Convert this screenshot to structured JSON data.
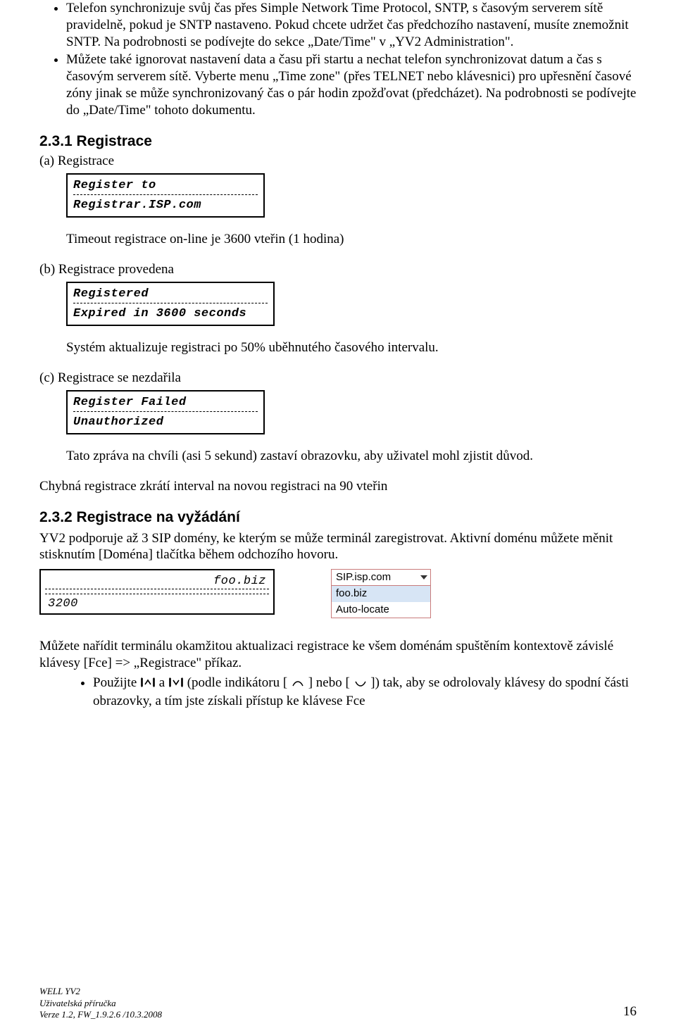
{
  "bullets": {
    "b1": "Telefon synchronizuje svůj čas přes Simple Network Time Protocol, SNTP, s časovým serverem sítě pravidelně, pokud je SNTP nastaveno. Pokud chcete udržet čas předchozího nastavení, musíte znemožnit SNTP. Na podrobnosti se podívejte do sekce „Date/Time\" v „YV2 Administration\".",
    "b2": "Můžete také ignorovat nastavení data a času při startu a nechat telefon synchronizovat datum a čas s časovým serverem sítě. Vyberte menu „Time zone\" (přes TELNET nebo klávesnici) pro upřesnění časové zóny jinak se může synchronizovaný čas o pár hodin zpožďovat (předcházet). Na podrobnosti se podívejte do „Date/Time\" tohoto dokumentu."
  },
  "sec231": {
    "title": "2.3.1  Registrace",
    "a_label": "(a) Registrace",
    "lcd_a_line1": "Register to",
    "lcd_a_line2": "Registrar.ISP.com",
    "a_note": "Timeout registrace on-line je 3600 vteřin (1 hodina)",
    "b_label": "(b) Registrace provedena",
    "lcd_b_line1": "Registered",
    "lcd_b_line2": "Expired in 3600 seconds",
    "b_note": "Systém aktualizuje registraci po 50% uběhnutého časového intervalu.",
    "c_label": "(c) Registrace se nezdařila",
    "lcd_c_line1": "Register Failed",
    "lcd_c_line2": "Unauthorized",
    "c_note1": "Tato zpráva na chvíli (asi 5 sekund) zastaví obrazovku, aby uživatel mohl zjistit důvod.",
    "c_note2": "Chybná registrace zkrátí interval na novou registraci na 90 vteřin"
  },
  "sec232": {
    "title": "2.3.2  Registrace na vyžádání",
    "intro": "YV2 podporuje až 3 SIP domény, ke kterým se může terminál zaregistrovat. Aktivní doménu můžete měnit stisknutím [Doména] tlačítka během odchozího hovoru.",
    "lcd_top": "foo.biz",
    "lcd_bot": "3200",
    "dd_head": "SIP.isp.com",
    "dd_opt1": "foo.biz",
    "dd_opt2": "Auto-locate",
    "para2": "Můžete nařídit terminálu okamžitou aktualizaci registrace ke všem doménám spuštěním kontextově závislé klávesy [Fce] => „Registrace\" příkaz.",
    "bullet_pre": "Použijte ",
    "bullet_mid1": " a ",
    "bullet_mid2": " (podle indikátoru [",
    "bullet_mid3": "] nebo [",
    "bullet_post": "]) tak, aby se odrolovaly klávesy do spodní části obrazovky, a tím jste získali přístup ke klávese Fce"
  },
  "footer": {
    "l1": "WELL YV2",
    "l2": "Uživatelská příručka",
    "l3": "Verze 1.2, FW_1.9.2.6 /10.3.2008",
    "page": "16"
  }
}
